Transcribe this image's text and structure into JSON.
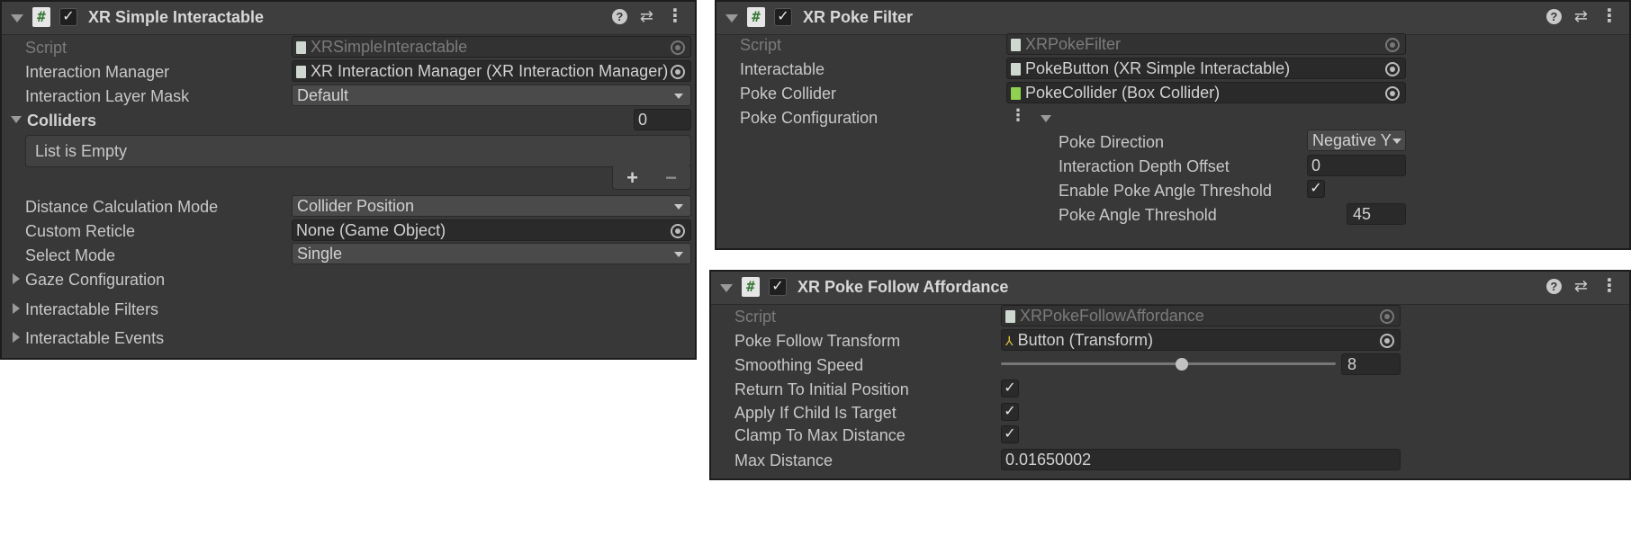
{
  "simple_interactable": {
    "title": "XR Simple Interactable",
    "script_label": "Script",
    "script_value": "XRSimpleInteractable",
    "interaction_manager_label": "Interaction Manager",
    "interaction_manager_value": "XR Interaction Manager (XR Interaction Manager)",
    "layer_mask_label": "Interaction Layer Mask",
    "layer_mask_value": "Default",
    "colliders_label": "Colliders",
    "colliders_count": "0",
    "list_empty": "List is Empty",
    "add_label": "+",
    "remove_label": "−",
    "distance_mode_label": "Distance Calculation Mode",
    "distance_mode_value": "Collider Position",
    "custom_reticle_label": "Custom Reticle",
    "custom_reticle_value": "None (Game Object)",
    "select_mode_label": "Select Mode",
    "select_mode_value": "Single",
    "gaze_config_label": "Gaze Configuration",
    "interactable_filters_label": "Interactable Filters",
    "interactable_events_label": "Interactable Events"
  },
  "poke_filter": {
    "title": "XR Poke Filter",
    "script_label": "Script",
    "script_value": "XRPokeFilter",
    "interactable_label": "Interactable",
    "interactable_value": "PokeButton (XR Simple Interactable)",
    "poke_collider_label": "Poke Collider",
    "poke_collider_value": "PokeCollider (Box Collider)",
    "poke_config_label": "Poke Configuration",
    "poke_direction_label": "Poke Direction",
    "poke_direction_value": "Negative Y",
    "depth_offset_label": "Interaction Depth Offset",
    "depth_offset_value": "0",
    "enable_angle_label": "Enable Poke Angle Threshold",
    "enable_angle_checked": true,
    "angle_threshold_label": "Poke Angle Threshold",
    "angle_threshold_value": "45"
  },
  "poke_follow": {
    "title": "XR Poke Follow Affordance",
    "script_label": "Script",
    "script_value": "XRPokeFollowAffordance",
    "follow_transform_label": "Poke Follow Transform",
    "follow_transform_value": "Button (Transform)",
    "smoothing_label": "Smoothing Speed",
    "smoothing_value": "8",
    "smoothing_fraction": 0.54,
    "return_label": "Return To Initial Position",
    "apply_child_label": "Apply If Child Is Target",
    "clamp_label": "Clamp To Max Distance",
    "max_distance_label": "Max Distance",
    "max_distance_value": "0.01650002"
  },
  "icons": {
    "check": "✓",
    "script": "#"
  },
  "colors": {
    "panel_bg": "#383838",
    "header_bg": "#3e3e3e",
    "field_bg": "#2a2a2a",
    "dropdown_bg": "#4a4a4a"
  }
}
